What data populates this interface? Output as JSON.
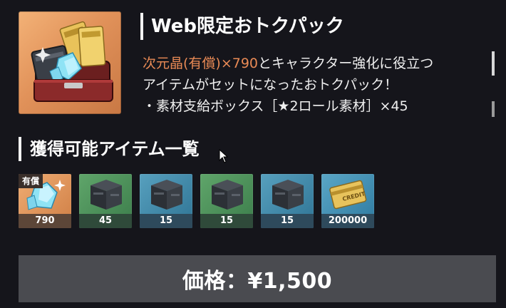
{
  "pack": {
    "title": "Web限定おトクパック",
    "description": {
      "line1_highlight": "次元晶(有償)×790",
      "line1_rest": "とキャラクター強化に役立つ",
      "line2": "アイテムがセットになったおトクパック！",
      "line3": "・素材支給ボックス［★2ロール素材］×45"
    }
  },
  "items_section": {
    "title": "獲得可能アイテム一覧",
    "items": [
      {
        "name": "次元晶",
        "badge": "有償",
        "qty": "790",
        "color": "orange",
        "icon": "crystal-icon"
      },
      {
        "name": "素材支給ボックス",
        "qty": "45",
        "color": "green",
        "icon": "crate-icon"
      },
      {
        "name": "素材支給ボックス",
        "qty": "15",
        "color": "blue",
        "icon": "crate-icon"
      },
      {
        "name": "素材支給ボックス",
        "qty": "15",
        "color": "green",
        "icon": "crate-icon"
      },
      {
        "name": "素材支給ボックス",
        "qty": "15",
        "color": "blue",
        "icon": "crate-icon"
      },
      {
        "name": "クレジット",
        "qty": "200000",
        "color": "cblue",
        "icon": "credit-card-icon",
        "card_text": "CREDIT"
      }
    ]
  },
  "price": {
    "label": "価格：¥1,500"
  },
  "colors": {
    "background": "#15151b",
    "highlight": "#e98a55",
    "price_bar": "#4a4b50"
  }
}
